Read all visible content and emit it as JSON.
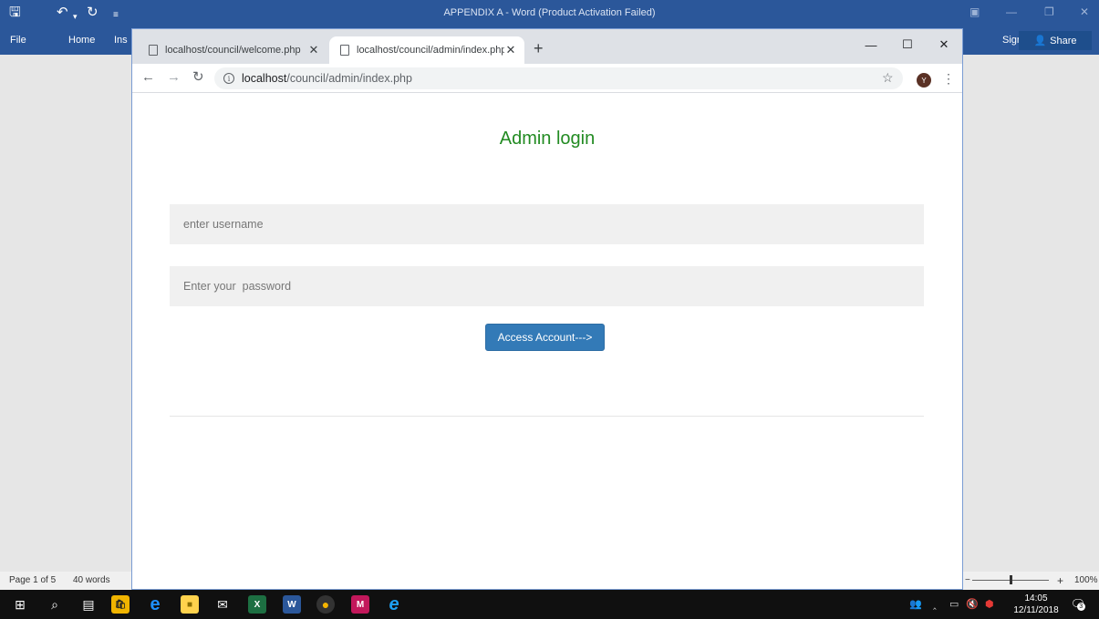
{
  "word": {
    "title": "APPENDIX A - Word (Product Activation Failed)",
    "ribbon_tabs": [
      "File",
      "Home",
      "Ins"
    ],
    "sign_in": "Sign in",
    "share": "Share",
    "status_page": "Page 1 of 5",
    "status_words": "40 words",
    "zoom_level": "100%"
  },
  "browser": {
    "tabs": [
      {
        "title": "localhost/council/welcome.php",
        "active": false
      },
      {
        "title": "localhost/council/admin/index.php",
        "active": true
      }
    ],
    "url_host": "localhost",
    "url_path": "/council/admin/index.php",
    "avatar_initial": "Y"
  },
  "page": {
    "title": "Admin login",
    "username_placeholder": "enter username",
    "password_placeholder": "Enter your  password",
    "submit_label": "Access Account--->",
    "title_color": "#228b22",
    "button_color": "#337ab7"
  },
  "taskbar": {
    "time": "14:05",
    "date": "12/11/2018",
    "notifications": "3"
  }
}
